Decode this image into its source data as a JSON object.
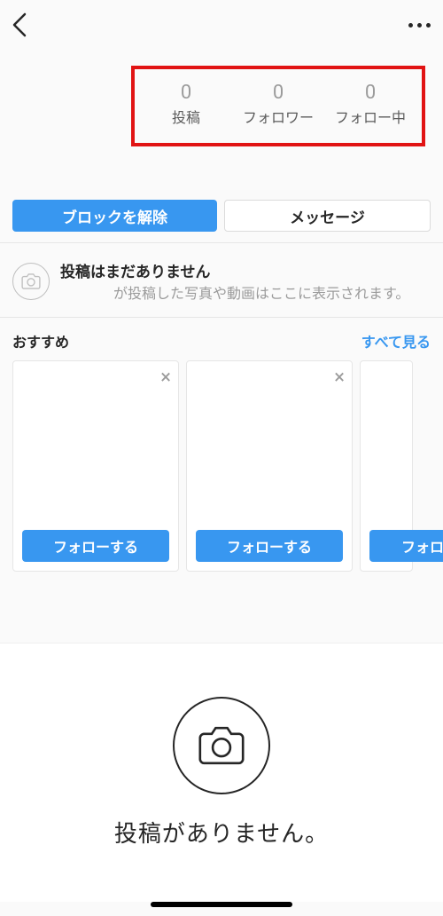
{
  "stats": {
    "posts": {
      "count": "0",
      "label": "投稿"
    },
    "followers": {
      "count": "0",
      "label": "フォロワー"
    },
    "following": {
      "count": "0",
      "label": "フォロー中"
    }
  },
  "actions": {
    "unblock": "ブロックを解除",
    "message": "メッセージ"
  },
  "emptyPosts": {
    "title": "投稿はまだありません",
    "subtitle": "が投稿した写真や動画はここに表示されます。"
  },
  "suggestions": {
    "title": "おすすめ",
    "seeAll": "すべて見る",
    "followLabel": "フォローする",
    "followPartial": "フォロ"
  },
  "bigEmpty": {
    "text": "投稿がありません。"
  }
}
